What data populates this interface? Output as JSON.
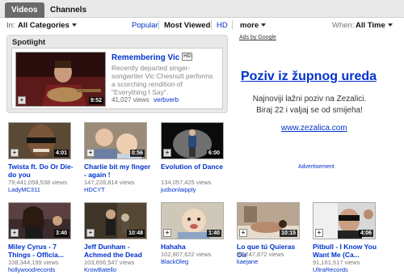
{
  "tabs": {
    "videos": "Videos",
    "channels": "Channels"
  },
  "filter": {
    "in_label": "In:",
    "category": "All Categories",
    "sort_options": [
      "Popular",
      "Most Viewed",
      "HD",
      "more"
    ],
    "selected_sort": "Most Viewed",
    "when_label": "When:",
    "when_value": "All Time"
  },
  "spotlight": {
    "heading": "Spotlight",
    "title": "Remembering Vic",
    "badge": "HD",
    "description": "Recently departed singer-songwriter Vic Chesnutt performs a scorching rendition of \"Everything I Say\".",
    "duration": "9:52",
    "views": "41,027 views",
    "user": "verbverb"
  },
  "videos": [
    {
      "title": "Twista ft. Do Or Die-do you",
      "duration": "4:01",
      "views": "79,441,058,538 views",
      "user": "LadyMC311"
    },
    {
      "title": "Charlie bit my finger - again !",
      "duration": "0:56",
      "views": "147,228,814 views",
      "user": "HDCYT"
    },
    {
      "title": "Evolution of Dance",
      "duration": "6:00",
      "views": "134,057,425 views",
      "user": "judsonlaipply"
    },
    {
      "title": "Miley Cyrus - 7 Things - Officia...",
      "duration": "3:40",
      "views": "108,344,199 views",
      "user": "hollywoodrecords"
    },
    {
      "title": "Jeff Dunham - Achmed the Dead",
      "duration": "10:48",
      "views": "103,656,547 views",
      "user": "KrowBatello"
    },
    {
      "title": "Hahaha",
      "duration": "1:40",
      "views": "102,807,622 views",
      "user": "BlackOleg"
    },
    {
      "title": "Lo que tú Quieras Oír",
      "duration": "10:15",
      "views": "99,247,872 views",
      "user": "kaejane"
    },
    {
      "title": "Pitbull - I Know You Want Me (Ca...",
      "duration": "4:06",
      "views": "91,161,517 views",
      "user": "UltraRecords"
    }
  ],
  "ad": {
    "ads_by": "Ads by Google",
    "title": "Poziv iz župnog ureda",
    "body": "Najnoviji lažni poziv na Zezalici. Biraj 22 i valjaj se od smijeha!",
    "url": "www.zezalica.com",
    "label": "Advertisement"
  },
  "colors": {
    "link": "#0033cc",
    "tab_active": "#6a6a6a",
    "spotlight_bg": "#e8e8e8"
  }
}
